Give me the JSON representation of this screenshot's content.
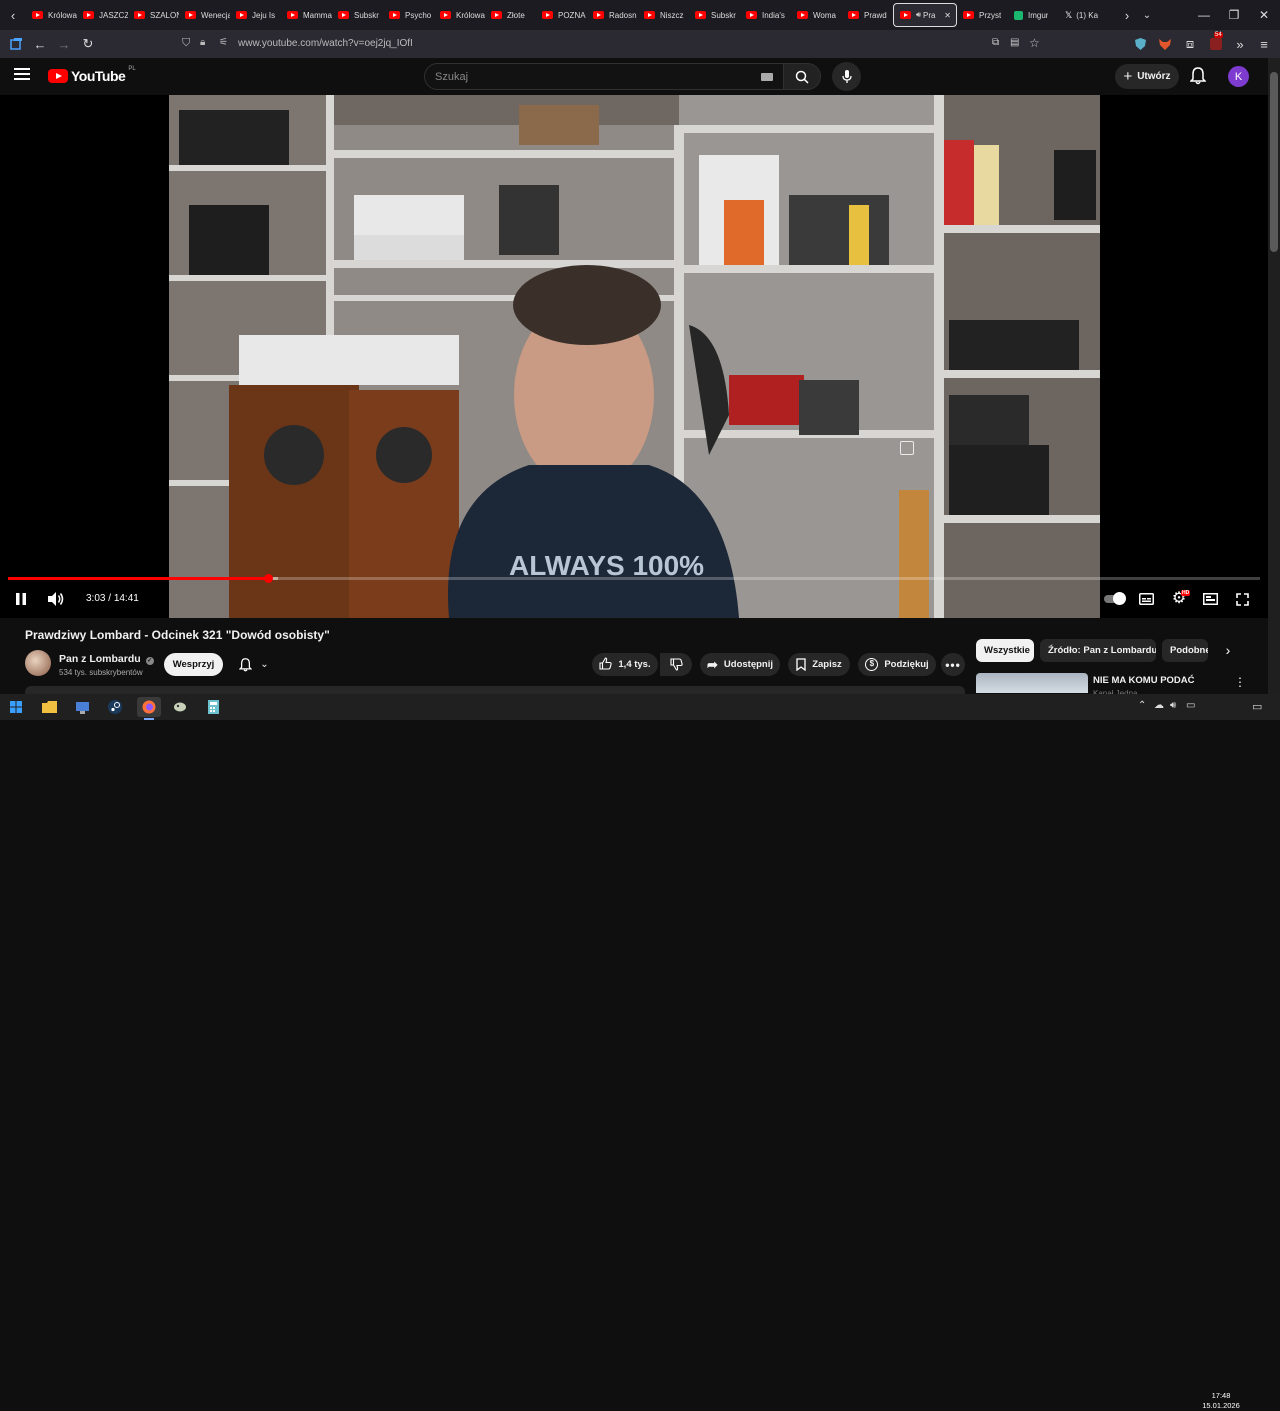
{
  "browser": {
    "tabs": [
      {
        "label": "Królowa"
      },
      {
        "label": "JASZCZ"
      },
      {
        "label": "SZALOŃ"
      },
      {
        "label": "Wenecja"
      },
      {
        "label": "Jeju Is"
      },
      {
        "label": "Mamma"
      },
      {
        "label": "Subskr"
      },
      {
        "label": "Psycho"
      },
      {
        "label": "Królowa"
      },
      {
        "label": "Złote"
      },
      {
        "label": "POZNA"
      },
      {
        "label": "Radosn"
      },
      {
        "label": "Niszcz"
      },
      {
        "label": "Subskr"
      },
      {
        "label": "India's"
      },
      {
        "label": "Woma"
      },
      {
        "label": "Prawd"
      },
      {
        "label": "Pra",
        "active": true
      },
      {
        "label": "Przyst"
      },
      {
        "label": "Imgur"
      },
      {
        "label": "(1) Ka"
      }
    ],
    "url": "www.youtube.com/watch?v=oej2jq_IOfI",
    "extension_badge": "54"
  },
  "youtube": {
    "logo_text": "YouTube",
    "region": "PL",
    "search_placeholder": "Szukaj",
    "create_label": "Utwórz",
    "avatar_letter": "K"
  },
  "player": {
    "current_time": "3:03",
    "duration": "14:41",
    "progress_fraction": 0.208,
    "buffered_fraction": 0.216,
    "settings_badge": "HD"
  },
  "video": {
    "title": "Prawdziwy Lombard - Odcinek 321 \"Dowód osobisty\"",
    "channel_name": "Pan z Lombardu",
    "subscribers": "534 tys. subskrybentów",
    "join_label": "Wesprzyj",
    "likes": "1,4 tys.",
    "share_label": "Udostępnij",
    "save_label": "Zapisz",
    "thanks_label": "Podziękuj"
  },
  "sidebar": {
    "chips": [
      {
        "label": "Wszystkie",
        "active": true
      },
      {
        "label": "Źródło: Pan z Lombardu"
      },
      {
        "label": "Podobne"
      }
    ],
    "recommendation": {
      "title": "NIE MA KOMU PODAĆ",
      "channel": "Kanał Jedna"
    }
  },
  "taskbar": {
    "time": "17:48",
    "date": "15.01.2026"
  },
  "colors": {
    "accent_red": "#ff0000",
    "avatar_purple": "#7e3bd0",
    "background": "#0f0f0f"
  }
}
